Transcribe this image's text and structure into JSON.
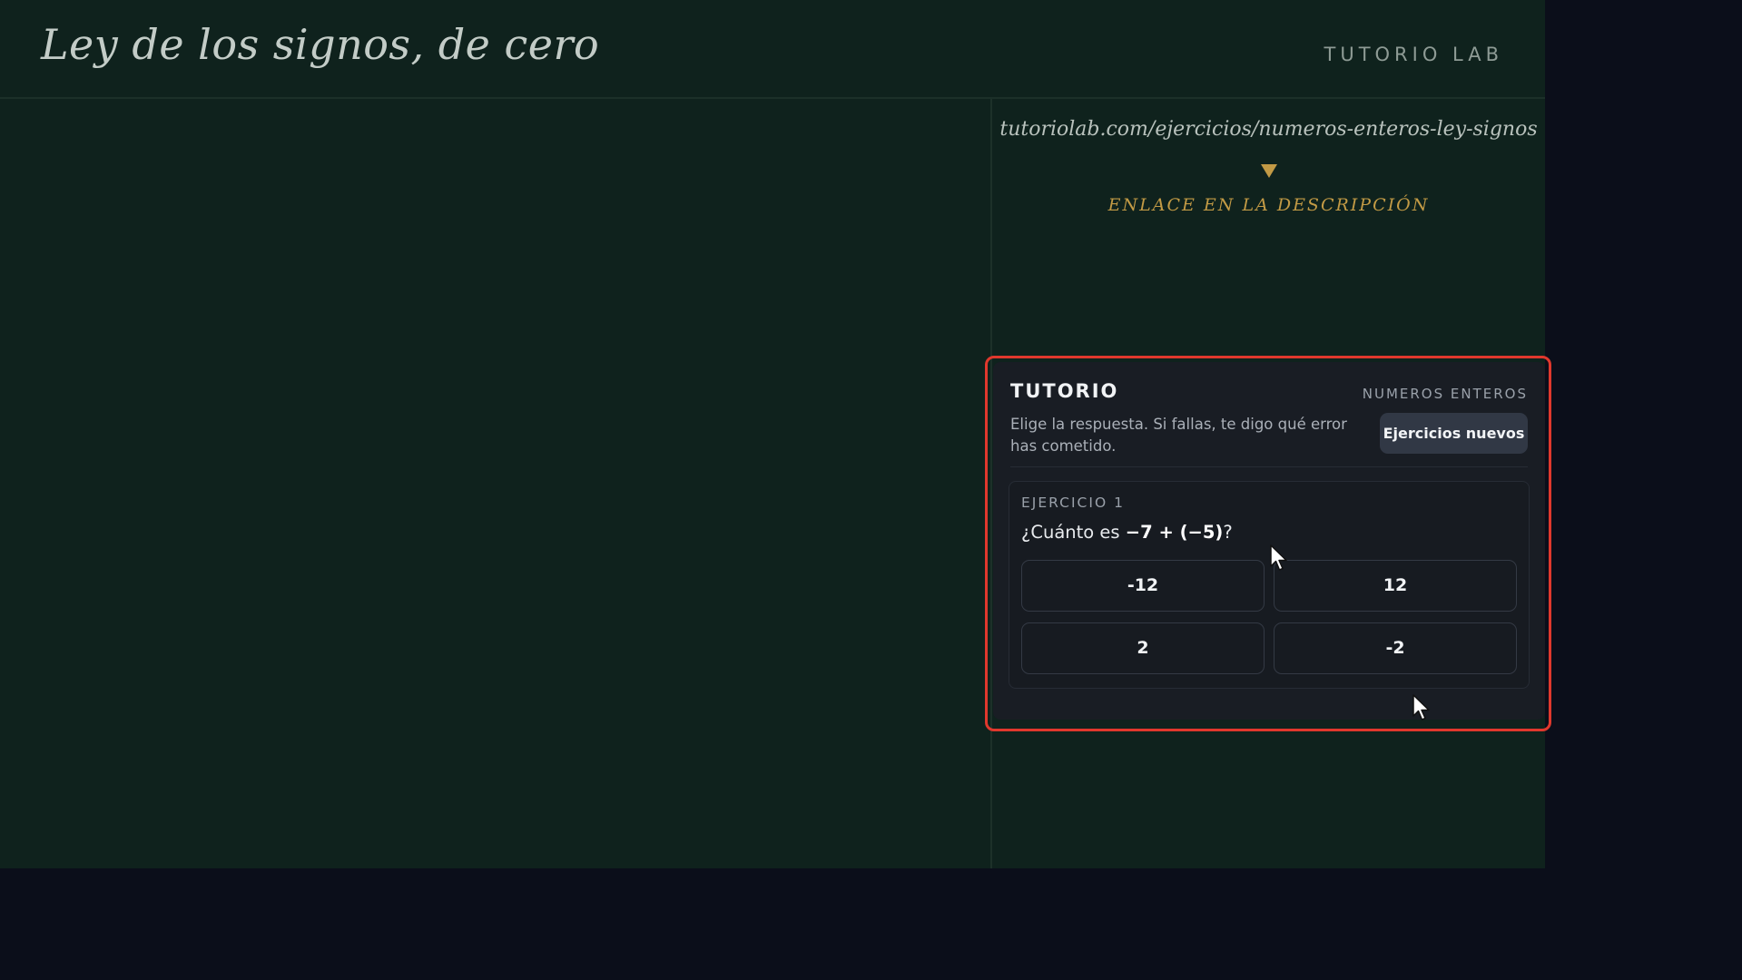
{
  "header": {
    "title": "Ley de los signos, de cero",
    "brand": "TUTORIO LAB"
  },
  "link": {
    "url": "tutoriolab.com/ejercicios/numeros-enteros-ley-signos",
    "arrow_icon": "down-triangle-icon",
    "cta": "ENLACE EN LA DESCRIPCIÓN"
  },
  "widget": {
    "title": "TUTORIO",
    "topic": "NUMEROS ENTEROS",
    "description": "Elige la respuesta. Si fallas, te digo qué error has cometido.",
    "new_button": "Ejercicios nuevos",
    "exercise": {
      "label": "EJERCICIO 1",
      "question_prefix": "¿Cuánto es ",
      "question_expr": "−7 + (−5)",
      "question_suffix": "?",
      "options": [
        "-12",
        "12",
        "2",
        "-2"
      ]
    }
  },
  "colors": {
    "board": "#0f221d",
    "accent": "#c29a45",
    "highlight": "#e0382d",
    "widget_bg": "#191d24"
  },
  "cursors": [
    "pointer-cursor-icon",
    "pointer-cursor-icon"
  ]
}
